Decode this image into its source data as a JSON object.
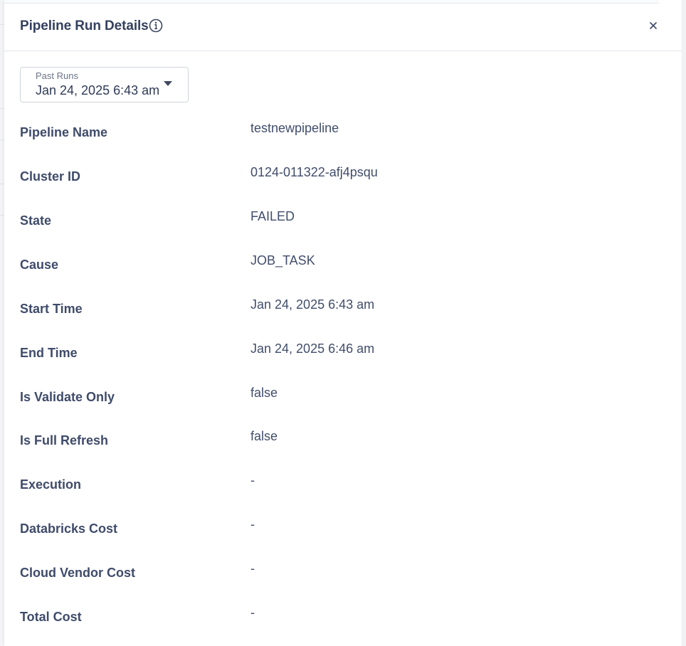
{
  "panel": {
    "title": "Pipeline Run Details",
    "info_icon": "info-icon",
    "close_label": "×"
  },
  "past_runs": {
    "label": "Past Runs",
    "selected": "Jan 24, 2025 6:43 am"
  },
  "details": [
    {
      "label": "Pipeline Name",
      "value": "testnewpipeline"
    },
    {
      "label": "Cluster ID",
      "value": "0124-011322-afj4psqu"
    },
    {
      "label": "State",
      "value": "FAILED"
    },
    {
      "label": "Cause",
      "value": "JOB_TASK"
    },
    {
      "label": "Start Time",
      "value": "Jan 24, 2025 6:43 am"
    },
    {
      "label": "End Time",
      "value": "Jan 24, 2025 6:46 am"
    },
    {
      "label": "Is Validate Only",
      "value": "false"
    },
    {
      "label": "Is Full Refresh",
      "value": "false"
    },
    {
      "label": "Execution",
      "value": "-"
    },
    {
      "label": "Databricks Cost",
      "value": "-"
    },
    {
      "label": "Cloud Vendor Cost",
      "value": "-"
    },
    {
      "label": "Total Cost",
      "value": "-"
    }
  ]
}
